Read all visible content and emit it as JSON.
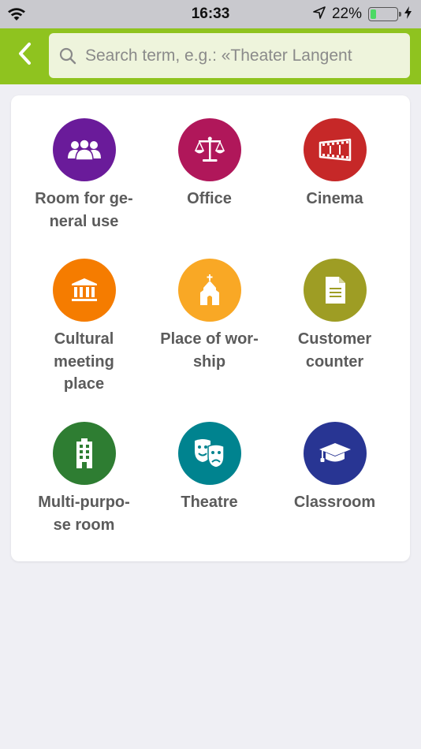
{
  "status_bar": {
    "time": "16:33",
    "battery_percent": "22%",
    "battery_level": 0.22,
    "icons": [
      "wifi-icon",
      "location-arrow-icon",
      "battery-icon",
      "charging-bolt-icon"
    ]
  },
  "header": {
    "back_icon": "chevron-left-icon",
    "search": {
      "placeholder": "Search term, e.g.: «Theater Langent",
      "value": "",
      "icon": "search-icon"
    },
    "accent_color": "#8fc31f"
  },
  "categories": [
    {
      "label": "Room for ge-\nneral use",
      "icon": "people-group-icon",
      "color": "#6a1b9a"
    },
    {
      "label": "Office",
      "icon": "scales-icon",
      "color": "#b0175a"
    },
    {
      "label": "Cinema",
      "icon": "film-reel-icon",
      "color": "#c62828"
    },
    {
      "label": "Cultural\nmeeting\nplace",
      "icon": "museum-building-icon",
      "color": "#f57c00"
    },
    {
      "label": "Place of wor-\nship",
      "icon": "chapel-icon",
      "color": "#f9a825"
    },
    {
      "label": "Customer\ncounter",
      "icon": "document-icon",
      "color": "#9e9d24"
    },
    {
      "label": "Multi-purpo-\nse room",
      "icon": "office-building-icon",
      "color": "#2e7d32"
    },
    {
      "label": "Theatre",
      "icon": "theatre-masks-icon",
      "color": "#00838f"
    },
    {
      "label": "Classroom",
      "icon": "graduation-cap-icon",
      "color": "#283593"
    }
  ]
}
